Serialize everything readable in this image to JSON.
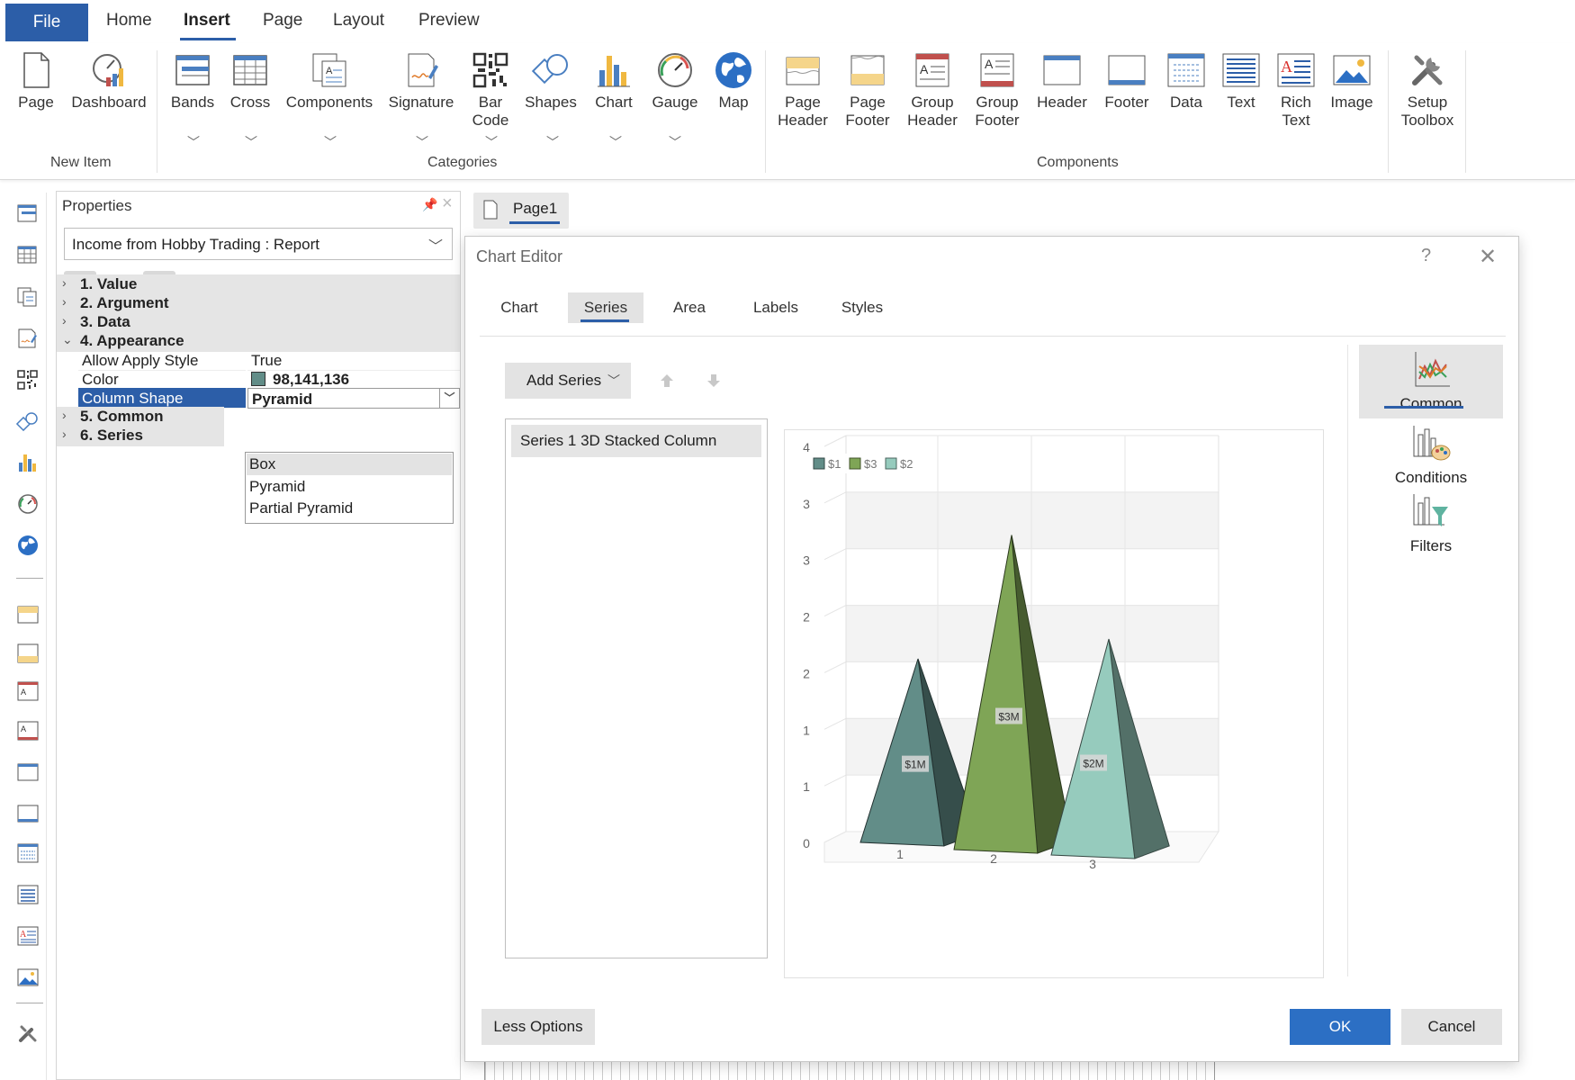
{
  "menu": {
    "file": "File",
    "items": [
      "Home",
      "Insert",
      "Page",
      "Layout",
      "Preview"
    ],
    "active": "Insert"
  },
  "ribbon": {
    "new_item": {
      "label": "New Item",
      "buttons": [
        [
          "Page"
        ],
        [
          "Dashboard"
        ]
      ]
    },
    "categories": {
      "label": "Categories",
      "buttons": [
        [
          "Bands"
        ],
        [
          "Cross"
        ],
        [
          "Components"
        ],
        [
          "Signature"
        ],
        [
          "Bar",
          "Code"
        ],
        [
          "Shapes"
        ],
        [
          "Chart"
        ],
        [
          "Gauge"
        ],
        [
          "Map"
        ]
      ]
    },
    "components": {
      "label": "Components",
      "buttons": [
        [
          "Page",
          "Header"
        ],
        [
          "Page",
          "Footer"
        ],
        [
          "Group",
          "Header"
        ],
        [
          "Group",
          "Footer"
        ],
        [
          "Header"
        ],
        [
          "Footer"
        ],
        [
          "Data"
        ],
        [
          "Text"
        ],
        [
          "Rich",
          "Text"
        ],
        [
          "Image"
        ]
      ]
    },
    "setup": [
      "Setup",
      "Toolbox"
    ]
  },
  "properties": {
    "title": "Properties",
    "selected_object": "Income from Hobby Trading : Report",
    "categories": [
      "1. Value",
      "2. Argument",
      "3. Data",
      "4. Appearance",
      "5. Common",
      "6. Series"
    ],
    "appearance": {
      "allow_apply_style": {
        "name": "Allow Apply Style",
        "value": "True"
      },
      "color": {
        "name": "Color",
        "value": "98,141,136",
        "swatch": "#628d88"
      },
      "column_shape": {
        "name": "Column Shape",
        "value": "Pyramid"
      }
    },
    "dropdown_options": [
      "Box",
      "Pyramid",
      "Partial Pyramid"
    ]
  },
  "page_tab": "Page1",
  "dialog": {
    "title": "Chart Editor",
    "help": "?",
    "tabs": [
      "Chart",
      "Series",
      "Area",
      "Labels",
      "Styles"
    ],
    "active_tab": "Series",
    "add_series": "Add Series",
    "series": [
      "Series 1 3D Stacked Column"
    ],
    "right_pane": [
      "Common",
      "Conditions",
      "Filters"
    ],
    "less_options": "Less Options",
    "ok": "OK",
    "cancel": "Cancel"
  },
  "chart_data": {
    "type": "bar",
    "style": "3D pyramid columns",
    "categories": [
      "1",
      "2",
      "3"
    ],
    "series": [
      {
        "name": "$1",
        "values": [
          1.8,
          null,
          null
        ],
        "color": "#628d88",
        "label": "$1M"
      },
      {
        "name": "$3",
        "values": [
          null,
          3.05,
          null
        ],
        "color": "#7fa556",
        "label": "$3M"
      },
      {
        "name": "$2",
        "values": [
          null,
          null,
          2.0
        ],
        "color": "#96cbbd",
        "label": "$2M"
      }
    ],
    "y_tick_labels": [
      "0",
      "1",
      "1",
      "2",
      "2",
      "3",
      "3",
      "4"
    ],
    "ylim": [
      0,
      4
    ],
    "legend": "top-left",
    "grid": true
  }
}
